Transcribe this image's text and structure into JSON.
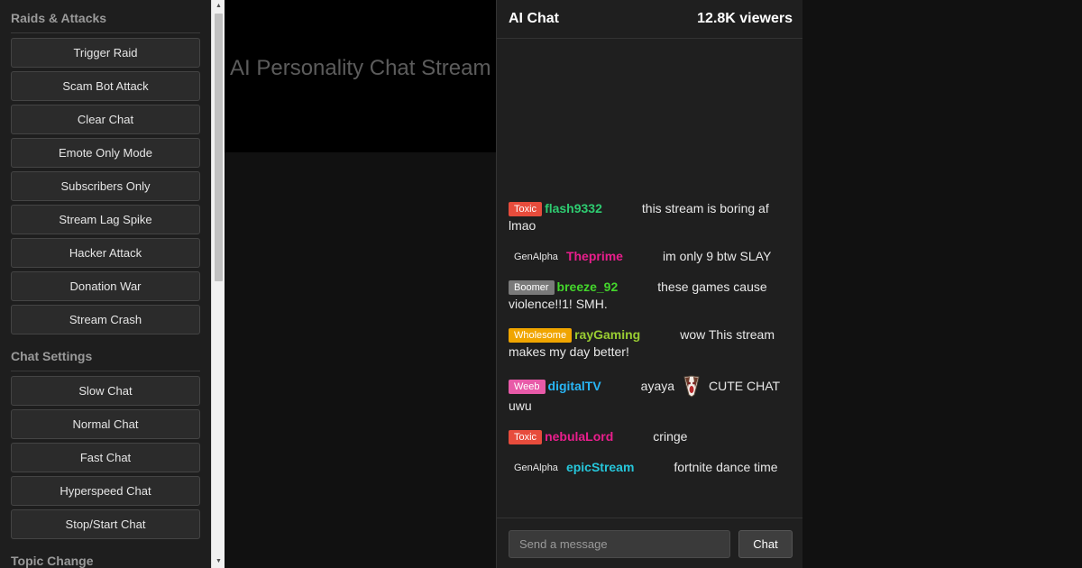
{
  "controls": {
    "raids_title": "Raids & Attacks",
    "raids_buttons": [
      "Trigger Raid",
      "Scam Bot Attack",
      "Clear Chat",
      "Emote Only Mode",
      "Subscribers Only",
      "Stream Lag Spike",
      "Hacker Attack",
      "Donation War",
      "Stream Crash"
    ],
    "settings_title": "Chat Settings",
    "settings_buttons": [
      "Slow Chat",
      "Normal Chat",
      "Fast Chat",
      "Hyperspeed Chat",
      "Stop/Start Chat"
    ],
    "topic_title": "Topic Change"
  },
  "stream": {
    "title": "AI Personality Chat Stream"
  },
  "chat": {
    "title": "AI Chat",
    "viewers": "12.8K viewers",
    "messages": [
      {
        "badge": "Toxic",
        "badge_type": "toxic",
        "user": "flash9332",
        "user_color": "#2ecc71",
        "text": "this stream is boring af lmao"
      },
      {
        "badge": "GenAlpha",
        "badge_type": "genalpha",
        "user": "Theprime",
        "user_color": "#e91e8c",
        "text": "im only 9 btw SLAY"
      },
      {
        "badge": "Boomer",
        "badge_type": "boomer",
        "user": "breeze_92",
        "user_color": "#44d62c",
        "text": "these games cause violence!!1! SMH."
      },
      {
        "badge": "Wholesome",
        "badge_type": "wholesome",
        "user": "rayGaming",
        "user_color": "#9acd32",
        "text": "wow This stream makes my day better!"
      },
      {
        "badge": "Weeb",
        "badge_type": "weeb",
        "user": "digitalTV",
        "user_color": "#29b6f6",
        "text_before": "ayaya",
        "emote": "ayaya-emote",
        "text": "CUTE CHAT uwu"
      },
      {
        "badge": "Toxic",
        "badge_type": "toxic",
        "user": "nebulaLord",
        "user_color": "#e91e8c",
        "text": "cringe"
      },
      {
        "badge": "GenAlpha",
        "badge_type": "genalpha",
        "user": "epicStream",
        "user_color": "#26c6da",
        "text": "fortnite dance time"
      }
    ],
    "input_placeholder": "Send a message",
    "send_label": "Chat"
  }
}
